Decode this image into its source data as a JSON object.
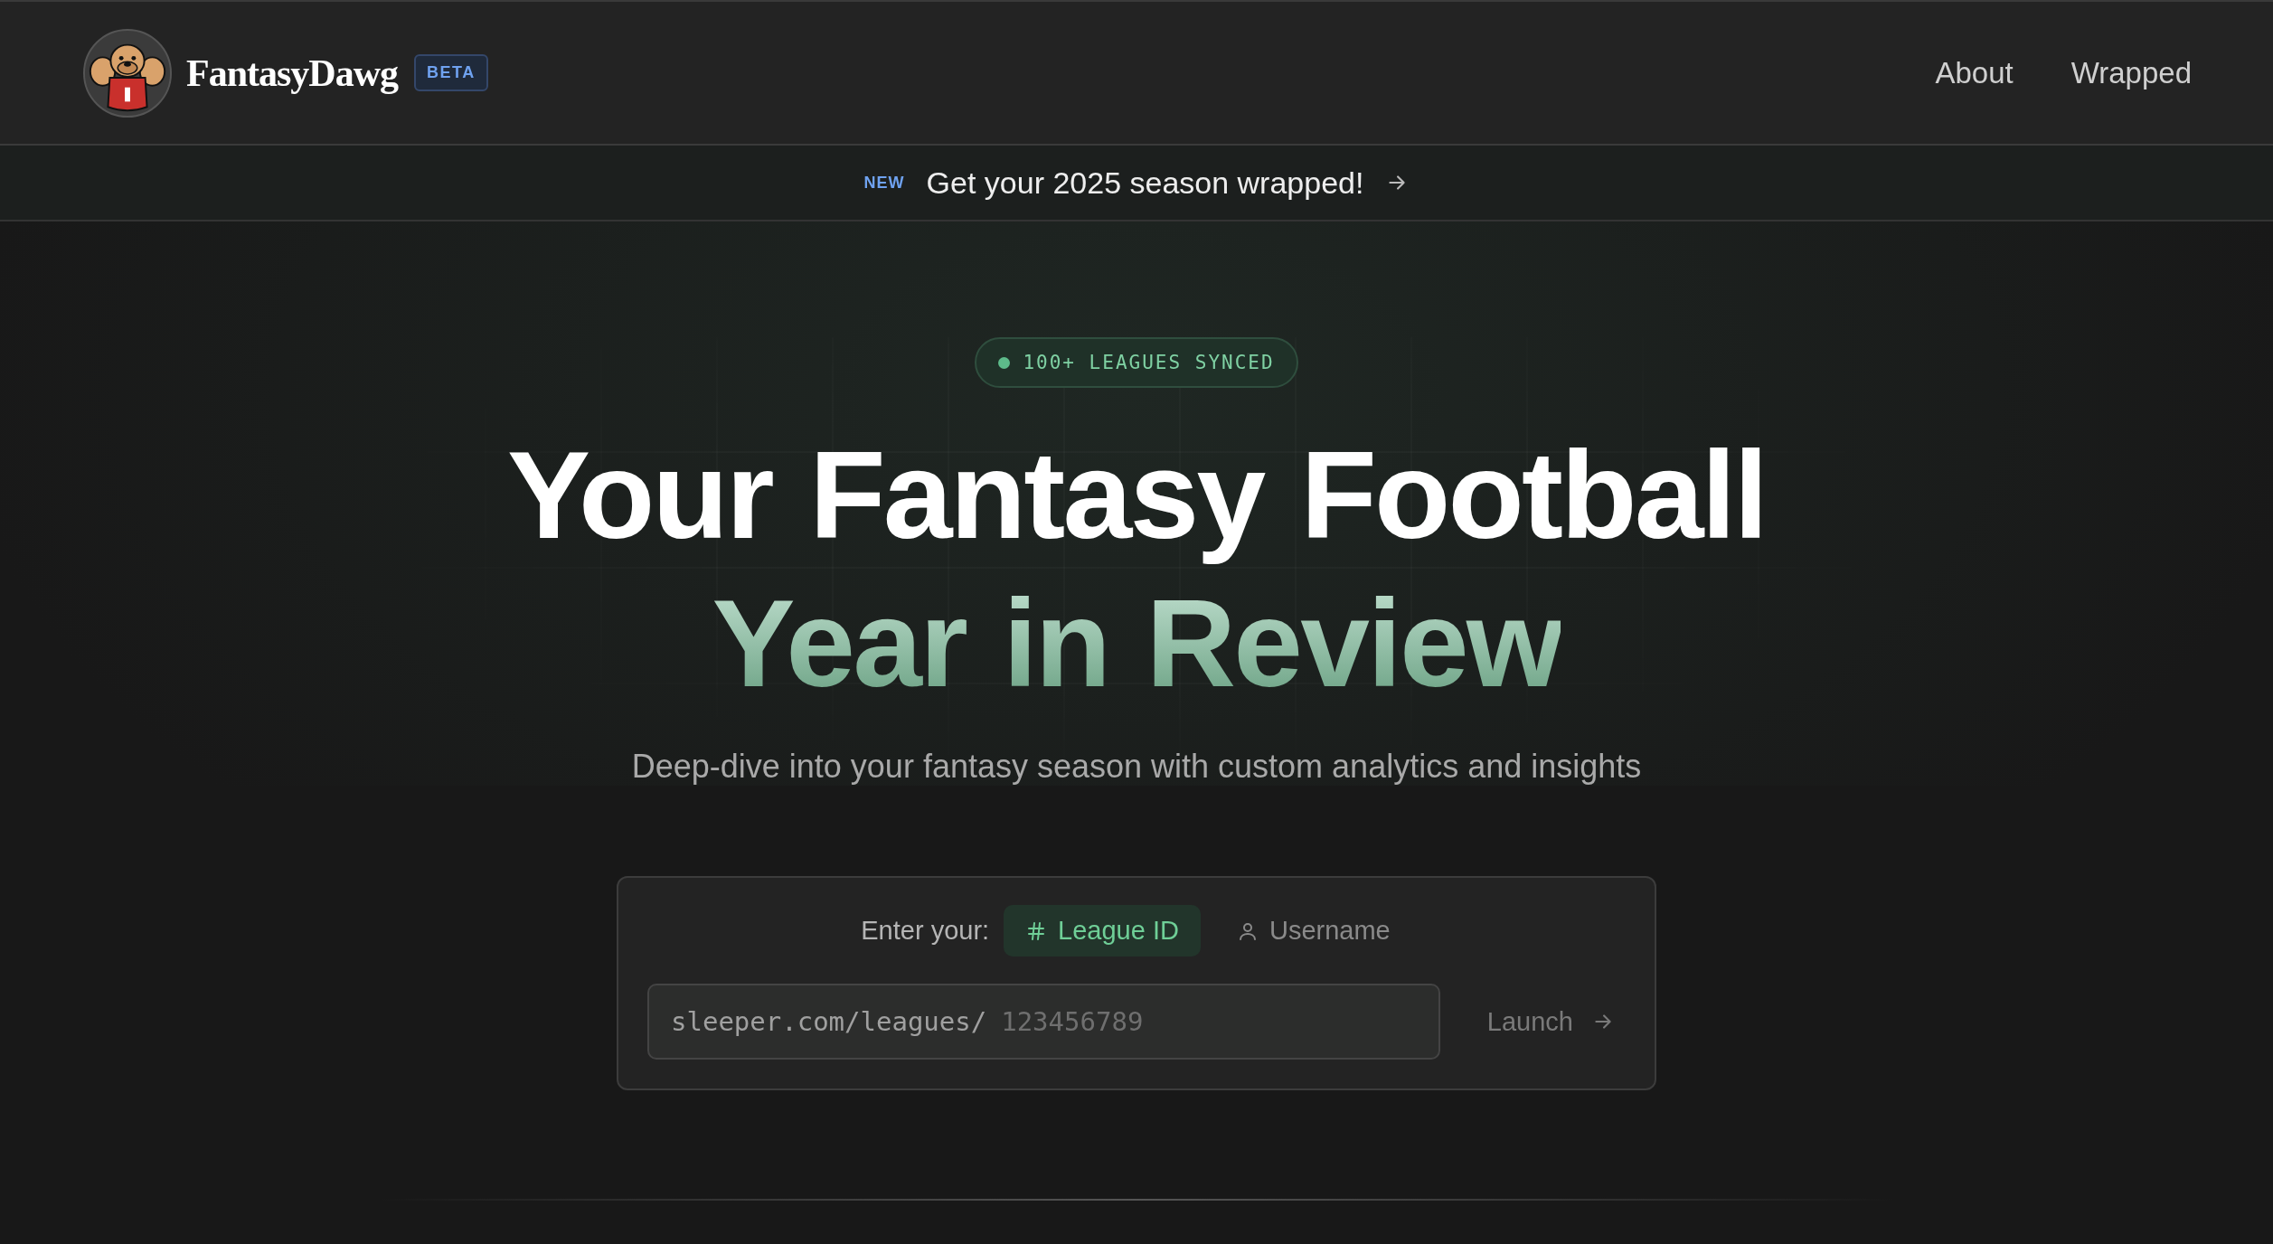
{
  "header": {
    "brand": "FantasyDawg",
    "badge": "BETA",
    "nav": [
      {
        "label": "About"
      },
      {
        "label": "Wrapped"
      }
    ]
  },
  "announcement": {
    "tag": "NEW",
    "text": "Get your 2025 season wrapped!"
  },
  "hero": {
    "status": "100+ LEAGUES SYNCED",
    "title_line_1": "Your Fantasy Football",
    "title_line_2": "Year in Review",
    "subtitle": "Deep-dive into your fantasy season with custom analytics and insights"
  },
  "lookup": {
    "label": "Enter your:",
    "modes": [
      {
        "label": "League ID",
        "kind": "hash",
        "selected": true
      },
      {
        "label": "Username",
        "kind": "user",
        "selected": false
      }
    ],
    "prefix": "sleeper.com/leagues/",
    "placeholder": "123456789",
    "submit": "Launch"
  }
}
